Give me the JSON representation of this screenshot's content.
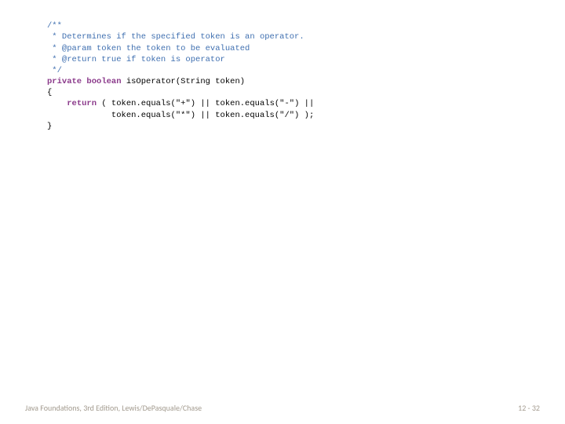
{
  "code": {
    "javadoc_l1": "/**",
    "javadoc_l2": " * Determines if the specified token is an operator.",
    "javadoc_l3": " * @param token the token to be evaluated",
    "javadoc_l4": " * @return true if token is operator",
    "javadoc_l5": " */",
    "kw_private": "private",
    "kw_boolean": "boolean",
    "method_sig": " isOperator(String token)",
    "brace_open": "{",
    "kw_return": "return",
    "body_l1": " ( token.equals(\"+\") || token.equals(\"-\") ||",
    "body_l2": "             token.equals(\"*\") || token.equals(\"/\") );",
    "brace_close": "}"
  },
  "footer": {
    "left": "Java Foundations, 3rd Edition, Lewis/DePasquale/Chase",
    "right": "12 - 32"
  }
}
